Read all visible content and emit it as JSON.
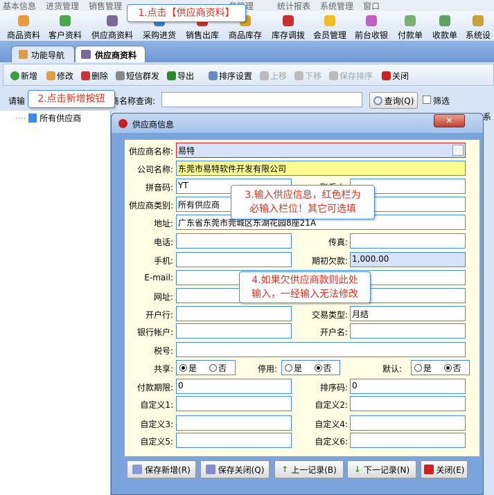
{
  "menu": [
    "基本信息",
    "进货管理",
    "销售管理",
    "务管理",
    "统计报表",
    "系统管理",
    "窗口"
  ],
  "toolbar": [
    {
      "label": "商品资料",
      "icon": "goods-icon",
      "color": "#e89a3c"
    },
    {
      "label": "客户资料",
      "icon": "customer-icon",
      "color": "#4aa84a"
    },
    {
      "label": "供应商资料",
      "icon": "supplier-icon",
      "color": "#7a6a9a"
    },
    {
      "label": "采购进货",
      "icon": "purchase-icon",
      "color": "#3d7bd8"
    },
    {
      "label": "销售出库",
      "icon": "sales-icon",
      "color": "#d03030"
    },
    {
      "label": "商品库存",
      "icon": "stock-icon",
      "color": "#d8a020"
    },
    {
      "label": "库存调拨",
      "icon": "transfer-icon",
      "color": "#c83030"
    },
    {
      "label": "会员管理",
      "icon": "member-icon",
      "color": "#f0c020"
    },
    {
      "label": "前台收银",
      "icon": "cashier-icon",
      "color": "#c060c0"
    },
    {
      "label": "付款单",
      "icon": "payment-icon",
      "color": "#7ab070"
    },
    {
      "label": "收款单",
      "icon": "receipt-icon",
      "color": "#60a060"
    },
    {
      "label": "系统设",
      "icon": "settings-icon",
      "color": "#c8a040"
    }
  ],
  "tabs": [
    {
      "label": "功能导航"
    },
    {
      "label": "供应商资料"
    }
  ],
  "actions": [
    {
      "label": "新增",
      "icon": "add-icon",
      "color": "#3aa03a",
      "enabled": true
    },
    {
      "label": "修改",
      "icon": "edit-icon",
      "color": "#e0a040",
      "enabled": true
    },
    {
      "label": "删除",
      "icon": "delete-icon",
      "color": "#d03030",
      "enabled": true
    },
    {
      "label": "短信群发",
      "icon": "sms-icon",
      "color": "#888",
      "enabled": true
    },
    {
      "label": "导出",
      "icon": "excel-icon",
      "color": "#2a8a2a",
      "enabled": true
    },
    {
      "label": "排序设置",
      "icon": "sort-icon",
      "color": "#6a8ac0",
      "enabled": true
    },
    {
      "label": "上移",
      "icon": "move-up-icon",
      "color": "#bbb",
      "enabled": false
    },
    {
      "label": "下移",
      "icon": "move-down-icon",
      "color": "#bbb",
      "enabled": false
    },
    {
      "label": "保存排序",
      "icon": "save-sort-icon",
      "color": "#bbb",
      "enabled": false
    },
    {
      "label": "关闭",
      "icon": "close-icon",
      "color": "#d02020",
      "enabled": true
    }
  ],
  "search": {
    "label_a": "请输",
    "label_b": "商名称查询:",
    "value": "",
    "query_button": "查询(Q)",
    "filter_label": "筛选"
  },
  "tree": {
    "root": "所有供应商"
  },
  "behind_text": "系",
  "dialog": {
    "title": "供应商信息",
    "fields": {
      "supplier_name": {
        "label": "供应商名称:",
        "value": "易特"
      },
      "company_name": {
        "label": "公司名称:",
        "value": "东莞市易特软件开发有限公司"
      },
      "pinyin": {
        "label": "拼音码:",
        "value": "YT"
      },
      "contact": {
        "label": "联系人:",
        "value": ""
      },
      "category": {
        "label": "供应商类别:",
        "value": "所有供应商"
      },
      "address": {
        "label": "地址:",
        "value": "广东省东莞市莞城区东湖花园8座21A"
      },
      "phone": {
        "label": "电话:",
        "value": ""
      },
      "fax": {
        "label": "传真:",
        "value": ""
      },
      "mobile": {
        "label": "手机:",
        "value": ""
      },
      "opening_debt": {
        "label": "期初欠款:",
        "value": "1,000.00"
      },
      "email": {
        "label": "E-mail:",
        "value": ""
      },
      "website": {
        "label": "网址:",
        "value": ""
      },
      "bank": {
        "label": "开户行:",
        "value": ""
      },
      "trade_type": {
        "label": "交易类型:",
        "value": "月结"
      },
      "bank_account": {
        "label": "银行帐户:",
        "value": ""
      },
      "account_name": {
        "label": "开户名:",
        "value": ""
      },
      "tax_no": {
        "label": "税号:",
        "value": ""
      },
      "payment_term": {
        "label": "付款期限:",
        "value": "0"
      },
      "sort_code": {
        "label": "排序码:",
        "value": "0"
      },
      "custom1": {
        "label": "自定义1:",
        "value": ""
      },
      "custom2": {
        "label": "自定义2:",
        "value": ""
      },
      "custom3": {
        "label": "自定义3:",
        "value": ""
      },
      "custom4": {
        "label": "自定义4:",
        "value": ""
      },
      "custom5": {
        "label": "自定义5:",
        "value": ""
      },
      "custom6": {
        "label": "自定义6:",
        "value": ""
      }
    },
    "radios": {
      "yes": "是",
      "no": "否",
      "shared": {
        "label": "共享:",
        "value": "是"
      },
      "disabled": {
        "label": "停用:",
        "value": "否"
      },
      "default": {
        "label": "默认:",
        "value": "否"
      }
    },
    "buttons": {
      "save_new": "保存新增(R)",
      "save_close": "保存关闭(Q)",
      "prev": "上一记录(B)",
      "next": "下一记录(N)",
      "close": "关闭(E)"
    }
  },
  "callouts": {
    "c1": "1.点击【供应商资料】",
    "c2": "2.点击新增按钮",
    "c3a": "3.输入供应信息，红色栏为",
    "c3b": "必输入栏位！其它可选填",
    "c4a": "4.如果欠供应商款则此处",
    "c4b": "输入，一经输入无法修改"
  }
}
